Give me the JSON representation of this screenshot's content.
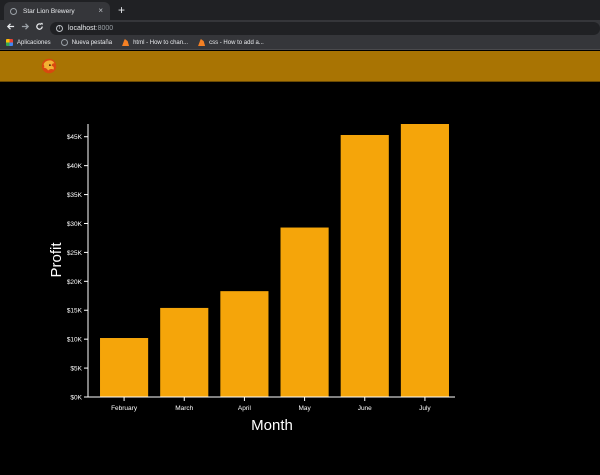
{
  "browser": {
    "tab_title": "Star Lion Brewery",
    "tab_close": "×",
    "new_tab": "+",
    "url_host": "localhost",
    "url_port": ":8000",
    "bookmarks": [
      {
        "label": "Aplicaciones",
        "icon": "apps-grid-icon"
      },
      {
        "label": "Nueva pestaña",
        "icon": "globe-icon"
      },
      {
        "label": "html - How to chan...",
        "icon": "stackoverflow-icon"
      },
      {
        "label": "css - How to add a...",
        "icon": "stackoverflow-icon"
      }
    ]
  },
  "colors": {
    "header_bg": "#a97403",
    "bar_fill": "#f5a50a",
    "background": "#000000"
  },
  "chart_data": {
    "type": "bar",
    "categories": [
      "February",
      "March",
      "April",
      "May",
      "June",
      "July"
    ],
    "values": [
      10200,
      15400,
      18300,
      29300,
      45300,
      47200
    ],
    "xlabel": "Month",
    "ylabel": "Profit",
    "ylim": [
      0,
      47200
    ],
    "yticks": [
      0,
      5000,
      10000,
      15000,
      20000,
      25000,
      30000,
      35000,
      40000,
      45000
    ],
    "ytick_labels": [
      "$0K",
      "$5K",
      "$10K",
      "$15K",
      "$20K",
      "$25K",
      "$30K",
      "$35K",
      "$40K",
      "$45K"
    ],
    "grid": false
  }
}
